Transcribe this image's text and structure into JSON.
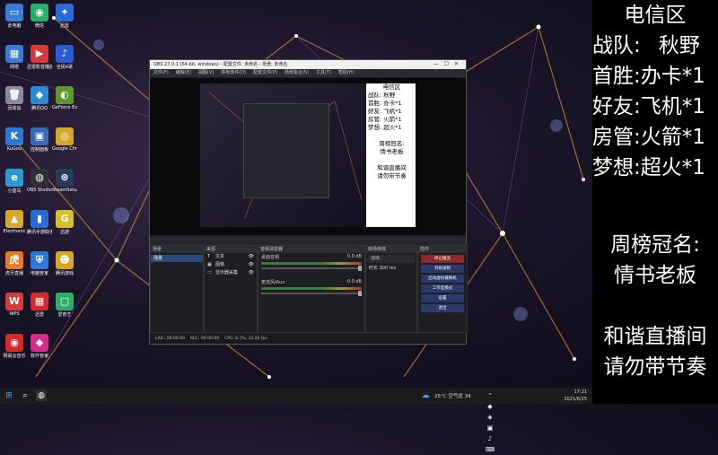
{
  "desktop_icons": [
    {
      "label": "此电脑",
      "icon": "computer-icon",
      "color": "#3a7bd5",
      "glyph": "▭"
    },
    {
      "label": "微信",
      "icon": "wechat-icon",
      "color": "#2aae67",
      "glyph": "◉"
    },
    {
      "label": "迅雷",
      "icon": "xunlei-icon",
      "color": "#2a6ad5",
      "glyph": "✦"
    },
    {
      "label": "网络",
      "icon": "network-icon",
      "color": "#3a7bd5",
      "glyph": "▦"
    },
    {
      "label": "迅雷影音播放器",
      "icon": "player-icon",
      "color": "#d53a3a",
      "glyph": "▶"
    },
    {
      "label": "全民K歌",
      "icon": "karaoke-icon",
      "color": "#2a5ad5",
      "glyph": "♪"
    },
    {
      "label": "回收站",
      "icon": "recycle-bin-icon",
      "color": "#8a8a9a",
      "glyph": "🗑"
    },
    {
      "label": "腾讯QQ",
      "icon": "qq-icon",
      "color": "#2a8ad5",
      "glyph": "◆"
    },
    {
      "label": "GeForce Experience",
      "icon": "nvidia-icon",
      "color": "#5a9a2a",
      "glyph": "◐"
    },
    {
      "label": "KuGou",
      "icon": "kugou-icon",
      "color": "#2a7ad5",
      "glyph": "K"
    },
    {
      "label": "控制面板",
      "icon": "control-panel-icon",
      "color": "#3a6ab5",
      "glyph": "▣"
    },
    {
      "label": "Google Chrome",
      "icon": "chrome-icon",
      "color": "#d5a82a",
      "glyph": "◎"
    },
    {
      "label": "小蓝鸟",
      "icon": "browser-icon",
      "color": "#2a9ad5",
      "glyph": "e"
    },
    {
      "label": "OBS Studio",
      "icon": "obs-icon",
      "color": "#303036",
      "glyph": "◍"
    },
    {
      "label": "SteamSetup",
      "icon": "steam-icon",
      "color": "#2a3a5a",
      "glyph": "⊛"
    },
    {
      "label": "Electronic",
      "icon": "game-icon",
      "color": "#d5a82a",
      "glyph": "▲"
    },
    {
      "label": "腾讯手游助手",
      "icon": "phone-app-icon",
      "color": "#2a6ad5",
      "glyph": "▮"
    },
    {
      "label": "迅游",
      "icon": "accelerator-icon",
      "color": "#d5c02a",
      "glyph": "G"
    },
    {
      "label": "虎牙直播",
      "icon": "huya-icon",
      "color": "#e57a2a",
      "glyph": "虎"
    },
    {
      "label": "电脑管家",
      "icon": "security-icon",
      "color": "#2a7ad5",
      "glyph": "⛨"
    },
    {
      "label": "腾讯游戏",
      "icon": "tencent-game-icon",
      "color": "#d5a82a",
      "glyph": "☻"
    },
    {
      "label": "WPS",
      "icon": "wps-icon",
      "color": "#d53a3a",
      "glyph": "W"
    },
    {
      "label": "迅雷",
      "icon": "thunder-icon",
      "color": "#d52a2a",
      "glyph": "▦"
    },
    {
      "label": "爱奇艺",
      "icon": "iqiyi-icon",
      "color": "#2aae67",
      "glyph": "▢"
    },
    {
      "label": "网易云音乐",
      "icon": "netease-music-icon",
      "color": "#d52a2a",
      "glyph": "◉"
    },
    {
      "label": "软件管家",
      "icon": "software-icon",
      "color": "#d52a8a",
      "glyph": "◆"
    }
  ],
  "obs": {
    "title": "OBS 27.0.1 (64-bit, windows) - 配置文件: 未命名 - 场景: 未命名",
    "menu": [
      "文件(F)",
      "编辑(E)",
      "视图(V)",
      "停靠部件(D)",
      "配置文件(P)",
      "场景集合(S)",
      "工具(T)",
      "帮助(H)"
    ],
    "preview_text": [
      "电信区",
      "战队: 秋野",
      "首胜: 办卡*1",
      "好友: 飞机*1",
      "房管: 火箭*1",
      "梦想: 超火*1",
      "",
      "周榜冠名:",
      "情书老板",
      "",
      "和谐直播间",
      "请勿带节奏"
    ],
    "docks": {
      "scenes": "场景",
      "sources": "来源",
      "mixer": "音频混音器",
      "transitions": "转场特效",
      "controls": "控件"
    },
    "scene_name": "场景",
    "sources": [
      "文本",
      "图像",
      "显示器采集"
    ],
    "mixer": [
      {
        "name": "桌面音频",
        "db": "0.0 dB"
      },
      {
        "name": "麦克风/Aux",
        "db": "0.0 dB"
      }
    ],
    "transition": {
      "name": "淡出",
      "duration_label": "时长",
      "duration": "300 ms"
    },
    "controls": [
      "停止推流",
      "开始录制",
      "启动虚拟摄像机",
      "工作室模式",
      "设置",
      "退出"
    ],
    "status": [
      "LIVE: 00:00:00",
      "REC: 00:00:00",
      "CPU: 6.7%, 30.00 fps"
    ]
  },
  "overlay": {
    "region": "电信区",
    "team_label": "战队:",
    "team_value": "秋野",
    "lines": [
      {
        "label": "首胜:",
        "value": "办卡*1"
      },
      {
        "label": "好友:",
        "value": "飞机*1"
      },
      {
        "label": "房管:",
        "value": "火箭*1"
      },
      {
        "label": "梦想:",
        "value": "超火*1"
      }
    ],
    "weekly_title": "周榜冠名:",
    "weekly_name": "情书老板",
    "notice_1": "和谐直播间",
    "notice_2": "请勿带节奏"
  },
  "taskbar": {
    "weather": "25°C 空气优 34",
    "time": "17:21",
    "date": "2021/6/25"
  }
}
